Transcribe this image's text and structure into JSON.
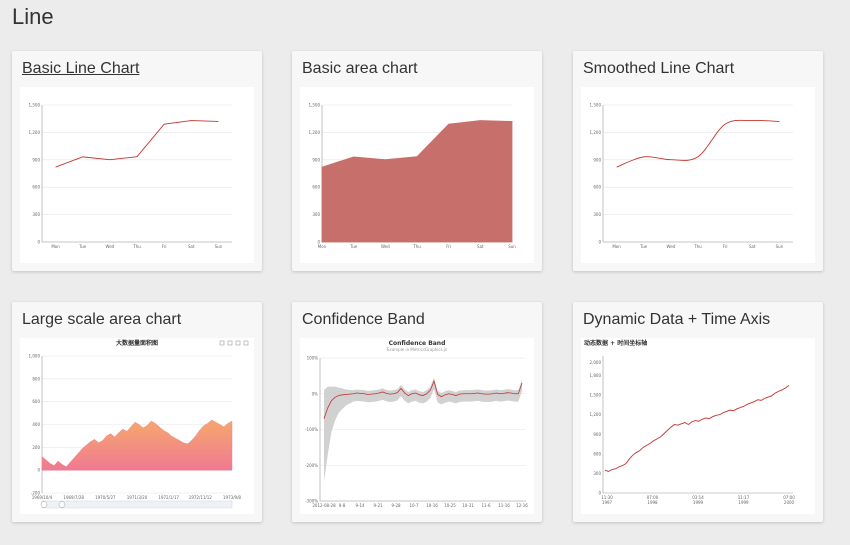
{
  "page": {
    "title": "Line"
  },
  "cards": [
    {
      "title": "Basic Line Chart"
    },
    {
      "title": "Basic area chart"
    },
    {
      "title": "Smoothed Line Chart"
    },
    {
      "title": "Large scale area chart"
    },
    {
      "title": "Confidence Band"
    },
    {
      "title": "Dynamic Data + Time Axis"
    }
  ],
  "colors": {
    "line": "#c23531",
    "area": "#c76f6b",
    "large_top": "#f5a86c",
    "large_bottom": "#f07a92",
    "band": "#cccccc"
  },
  "chart_data": [
    {
      "type": "line",
      "categories": [
        "Mon",
        "Tue",
        "Wed",
        "Thu",
        "Fri",
        "Sat",
        "Sun"
      ],
      "values": [
        820,
        932,
        901,
        934,
        1290,
        1330,
        1320
      ],
      "y_ticks": [
        "0",
        "300",
        "600",
        "900",
        "1,200",
        "1,500"
      ],
      "ylim": [
        0,
        1500
      ]
    },
    {
      "type": "area",
      "categories": [
        "Mon",
        "Tue",
        "Wed",
        "Thu",
        "Fri",
        "Sat",
        "Sun"
      ],
      "values": [
        820,
        932,
        901,
        934,
        1290,
        1330,
        1320
      ],
      "y_ticks": [
        "0",
        "300",
        "600",
        "900",
        "1,200",
        "1,500"
      ],
      "ylim": [
        0,
        1500
      ]
    },
    {
      "type": "line",
      "smooth": true,
      "categories": [
        "Mon",
        "Tue",
        "Wed",
        "Thu",
        "Fri",
        "Sat",
        "Sun"
      ],
      "values": [
        820,
        932,
        901,
        934,
        1290,
        1330,
        1320
      ],
      "y_ticks": [
        "0",
        "300",
        "600",
        "900",
        "1,200",
        "1,500"
      ],
      "ylim": [
        0,
        1500
      ]
    },
    {
      "type": "area",
      "title": "大数据量面积图",
      "x_ticks": [
        "1969/10/4",
        "1969/7/28",
        "1970/5/27",
        "1971/3/20",
        "1972/1/17",
        "1972/11/12",
        "1973/9/8"
      ],
      "y_ticks": [
        "-200",
        "0",
        "200",
        "400",
        "600",
        "800",
        "1,000"
      ],
      "ylim": [
        -200,
        1000
      ],
      "values": [
        120,
        90,
        60,
        40,
        80,
        50,
        30,
        70,
        110,
        150,
        190,
        220,
        250,
        270,
        240,
        260,
        300,
        320,
        290,
        330,
        360,
        340,
        380,
        420,
        400,
        370,
        390,
        430,
        410,
        380,
        350,
        330,
        300,
        280,
        260,
        240,
        230,
        260,
        300,
        350,
        390,
        410,
        440,
        420,
        400,
        380,
        410,
        430
      ]
    },
    {
      "type": "line",
      "title": "Confidence Band",
      "subtitle": "Example in MetricsGraphics.js",
      "x_ticks": [
        "2012-08-28",
        "9-8",
        "9-14",
        "9-21",
        "9-28",
        "10-7",
        "10-16",
        "10-25",
        "10-31",
        "11-6",
        "11-16",
        "12-16"
      ],
      "y_ticks": [
        "100%",
        "0%",
        "-100%",
        "-200%",
        "-300%"
      ],
      "ylim": [
        -300,
        100
      ],
      "values": [
        -70,
        -40,
        -20,
        -10,
        -5,
        -3,
        -2,
        -1,
        0,
        2,
        1,
        0,
        -2,
        -1,
        0,
        2,
        5,
        1,
        -1,
        0,
        3,
        15,
        2,
        -5,
        0,
        2,
        -3,
        -5,
        0,
        10,
        35,
        -2,
        -8,
        -3,
        0,
        -2,
        -5,
        -1,
        0,
        0,
        0,
        1,
        2,
        0,
        -1,
        -1,
        0,
        2,
        0,
        1,
        3,
        2,
        0,
        0,
        30
      ],
      "band_width": [
        80,
        60,
        40,
        30,
        22,
        18,
        14,
        12,
        10,
        10,
        10,
        10,
        10,
        10,
        10,
        10,
        10,
        10,
        10,
        10,
        10,
        10,
        10,
        10,
        10,
        10,
        10,
        10,
        10,
        10,
        10,
        10,
        10,
        10,
        10,
        10,
        10,
        10,
        10,
        10,
        10,
        10,
        10,
        10,
        10,
        10,
        10,
        10,
        10,
        10,
        10,
        10,
        10,
        10,
        10
      ]
    },
    {
      "type": "line",
      "title": "动态数据 + 时间坐标轴",
      "x_ticks": [
        "11:30\n1997",
        "07:00\n1998",
        "03:14\n1999",
        "11:17\n1999",
        "07:00\n2000"
      ],
      "y_ticks": [
        "0",
        "300",
        "600",
        "900",
        "1,200",
        "1,500",
        "1,800",
        "2,000"
      ],
      "ylim": [
        0,
        2100
      ],
      "values": [
        350,
        330,
        360,
        370,
        400,
        420,
        450,
        520,
        580,
        620,
        650,
        700,
        730,
        760,
        800,
        830,
        860,
        910,
        960,
        1010,
        1050,
        1040,
        1060,
        1080,
        1050,
        1090,
        1110,
        1100,
        1130,
        1150,
        1140,
        1170,
        1190,
        1200,
        1230,
        1250,
        1270,
        1260,
        1290,
        1310,
        1330,
        1360,
        1380,
        1400,
        1430,
        1420,
        1450,
        1470,
        1490,
        1530,
        1560,
        1580,
        1610,
        1650
      ]
    }
  ]
}
